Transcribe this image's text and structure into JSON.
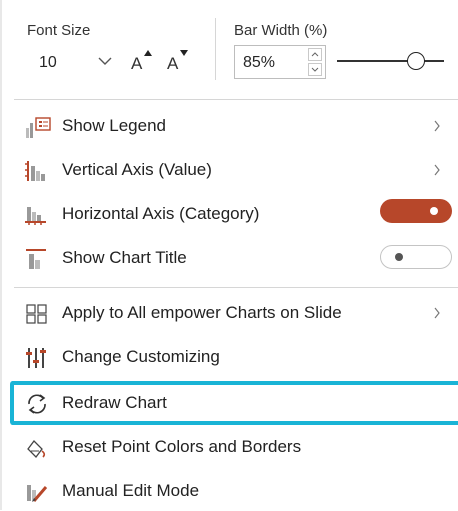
{
  "font_size": {
    "label": "Font Size",
    "value": "10",
    "grow_label": "A",
    "shrink_label": "A"
  },
  "bar_width": {
    "label": "Bar Width (%)",
    "value": "85%",
    "slider_level": 0.75
  },
  "menu": {
    "show_legend": "Show Legend",
    "vertical_axis": "Vertical Axis (Value)",
    "horizontal_axis": "Horizontal Axis (Category)",
    "show_chart_title": "Show Chart Title",
    "apply_all": "Apply to All empower Charts on Slide",
    "change_customizing": "Change Customizing",
    "redraw_chart": "Redraw Chart",
    "reset_point_colors": "Reset Point Colors and Borders",
    "manual_edit_mode": "Manual Edit Mode"
  },
  "toggles": {
    "horizontal_axis_on": true,
    "show_chart_title_on": false
  },
  "colors": {
    "toggle_on": "#b7472a",
    "highlight": "#19b4d6"
  },
  "icons": {
    "show_legend": "legend-icon",
    "vertical_axis": "vertical-axis-icon",
    "horizontal_axis": "horizontal-axis-icon",
    "show_chart_title": "chart-title-icon",
    "apply_all": "grid-icon",
    "change_customizing": "sliders-icon",
    "redraw_chart": "refresh-icon",
    "reset_point_colors": "reset-colors-icon",
    "manual_edit_mode": "edit-chart-icon"
  }
}
